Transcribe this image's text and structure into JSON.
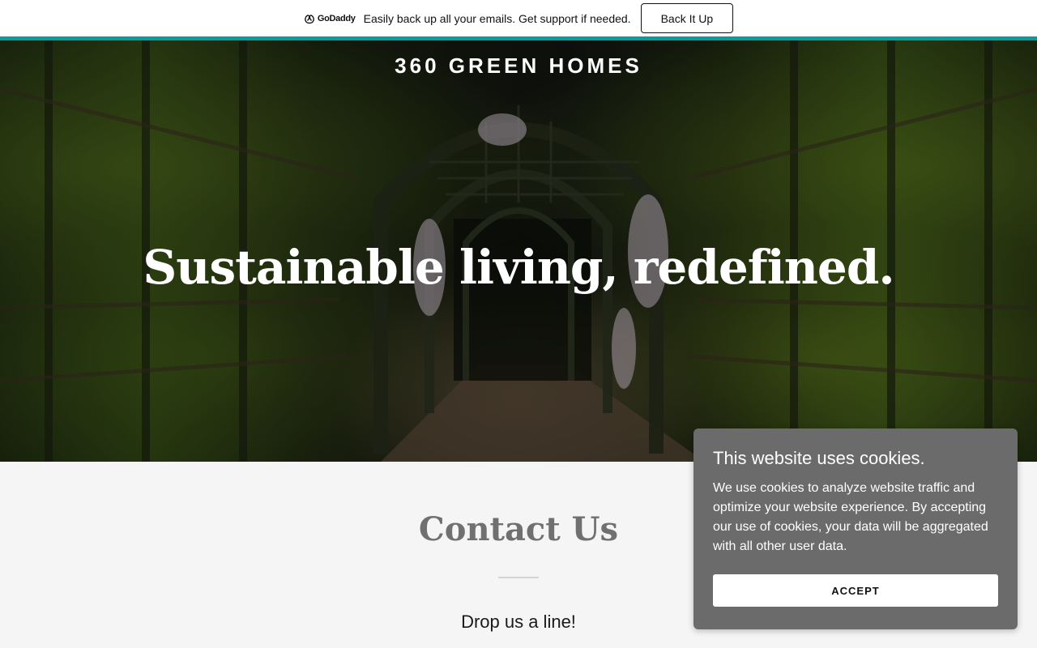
{
  "banner": {
    "logo_text": "GoDaddy",
    "message": "Easily back up all your emails. Get support if needed.",
    "button_label": "Back It Up",
    "accent_color": "#099c9c"
  },
  "hero": {
    "site_title": "360 GREEN HOMES",
    "headline": "Sustainable living, redefined."
  },
  "contact": {
    "title": "Contact Us",
    "subtitle": "Drop us a line!"
  },
  "cookie_banner": {
    "title": "This website uses cookies.",
    "body": "We use cookies to analyze website traffic and optimize your website experience. By accepting our use of cookies, your data will be aggregated with all other user data.",
    "accept_label": "ACCEPT",
    "background_color": "#6b6b6b"
  }
}
